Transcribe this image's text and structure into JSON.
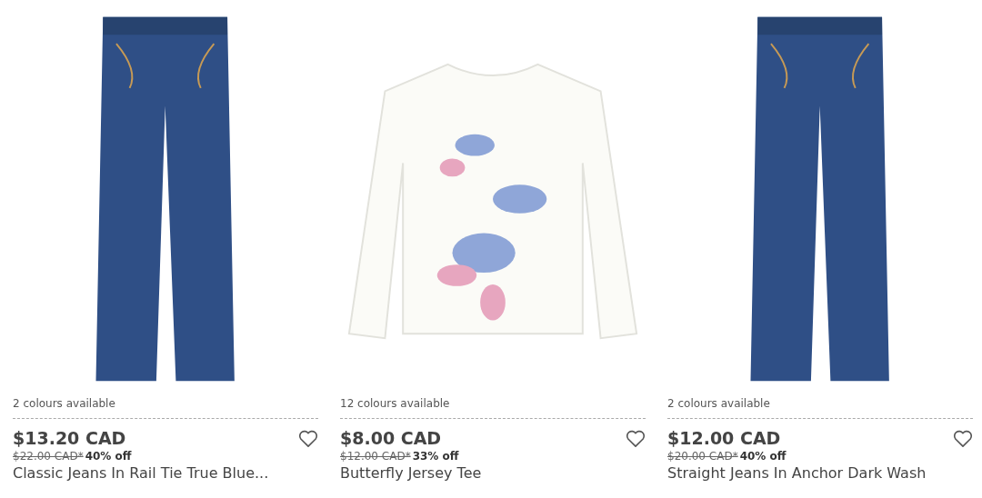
{
  "products": [
    {
      "kind": "jeans",
      "colours": "2 colours available",
      "price": "$13.20 CAD",
      "was_price": "$22.00 CAD*",
      "discount": "40% off",
      "name": "Classic Jeans In Rail Tie True Blue...",
      "saved": false
    },
    {
      "kind": "tee",
      "colours": "12 colours available",
      "price": "$8.00 CAD",
      "was_price": "$12.00 CAD*",
      "discount": "33% off",
      "name": "Butterfly Jersey Tee",
      "saved": false
    },
    {
      "kind": "jeans",
      "colours": "2 colours available",
      "price": "$12.00 CAD",
      "was_price": "$20.00 CAD*",
      "discount": "40% off",
      "name": "Straight Jeans In Anchor Dark Wash",
      "saved": false
    }
  ]
}
